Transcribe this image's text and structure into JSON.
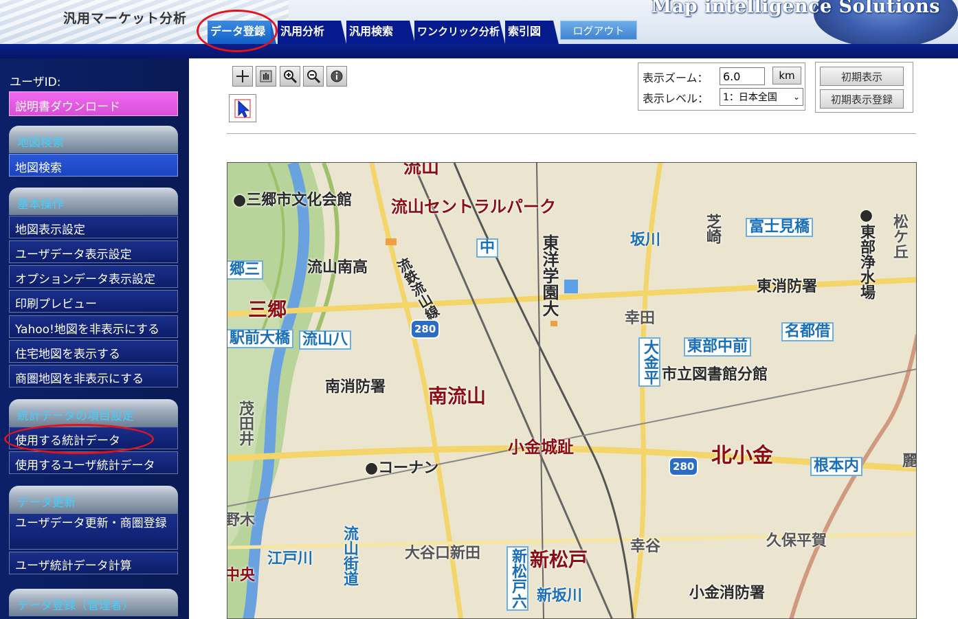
{
  "header": {
    "app_title": "汎用マーケット分析",
    "brand": "Map intelligence Solutions",
    "tabs": [
      {
        "label": "データ登録",
        "active": true
      },
      {
        "label": "汎用分析"
      },
      {
        "label": "汎用検索"
      },
      {
        "label": "ワンクリック分析"
      },
      {
        "label": "索引図"
      }
    ],
    "logout_label": "ログアウト"
  },
  "sidebar": {
    "userid_label": "ユーザID:",
    "manual_button": "説明書ダウンロード",
    "sections": [
      {
        "title": "地図検索",
        "items": [
          "地図検索"
        ]
      },
      {
        "title": "基本操作",
        "items": [
          "地図表示設定",
          "ユーザデータ表示設定",
          "オプションデータ表示設定",
          "印刷プレビュー",
          "Yahoo!地図を非表示にする",
          "住宅地図を表示する",
          "商圏地図を非表示にする"
        ]
      },
      {
        "title": "統計データの項目設定",
        "items": [
          "使用する統計データ",
          "使用するユーザ統計データ"
        ]
      },
      {
        "title": "データ更新",
        "items": [
          "ユーザデータ更新・商圏登録",
          "ユーザ統計データ計算"
        ]
      },
      {
        "title": "データ登録（管理者）",
        "items": []
      }
    ]
  },
  "toolbar": {
    "zoom_label": "表示ズーム：",
    "zoom_value": "6.0",
    "km_button": "km",
    "level_label": "表示レベル：",
    "level_value": "1：日本全国",
    "initial_view_button": "初期表示",
    "initial_register_button": "初期表示登録"
  },
  "map": {
    "labels": {
      "nagareyama_top": "流山",
      "misato_bunka": "●三郷市文化会館",
      "central_park": "流山セントラルパーク",
      "higashi_label": "東",
      "station_naka": "中",
      "toyo_gakuen": "東洋学園大",
      "sakagawa": "坂川",
      "shiba": "芝崎",
      "fujimibashi": "富士見橋",
      "higashi_jousui": "●東部浄水場",
      "matsugaoka": "松ケ丘",
      "goumisato": "郷三",
      "nagareyama_minami_high": "流山南高",
      "ryutetsu_line": "流鉄流山線",
      "higashi_fire": "東消防署",
      "misato_station": "三郷",
      "saita": "幸田",
      "nadokaru": "名都借",
      "ekimae_ohashi": "駅前大橋",
      "nagareyama8": "流山八",
      "route280_a": "280",
      "okanehira": "大金平",
      "tobu_nakamae": "東部中前",
      "library": "市立図書館分館",
      "minami_fire": "南消防署",
      "minami_nagareyama": "南流山",
      "shigeta": "茂田井",
      "koganejoshi": "小金城趾",
      "kita_kogane": "北小金",
      "route280_b": "280",
      "nemotouchi": "根本内",
      "kohnan": "●コーナン",
      "nomoku": "野木",
      "nagareyama_kaido": "流山街道",
      "kubohiraga": "久保平賀",
      "edogawa": "江戸川",
      "oyaguchi_shinden": "大谷口新田",
      "shinmatsudo_roku": "新松戸六",
      "shinmatsudo": "新松戸",
      "saiwaiya": "幸谷",
      "chuou": "中央",
      "shinsakagawa": "新坂川",
      "kogane_fire": "小金消防署",
      "reizan": "麗"
    }
  }
}
